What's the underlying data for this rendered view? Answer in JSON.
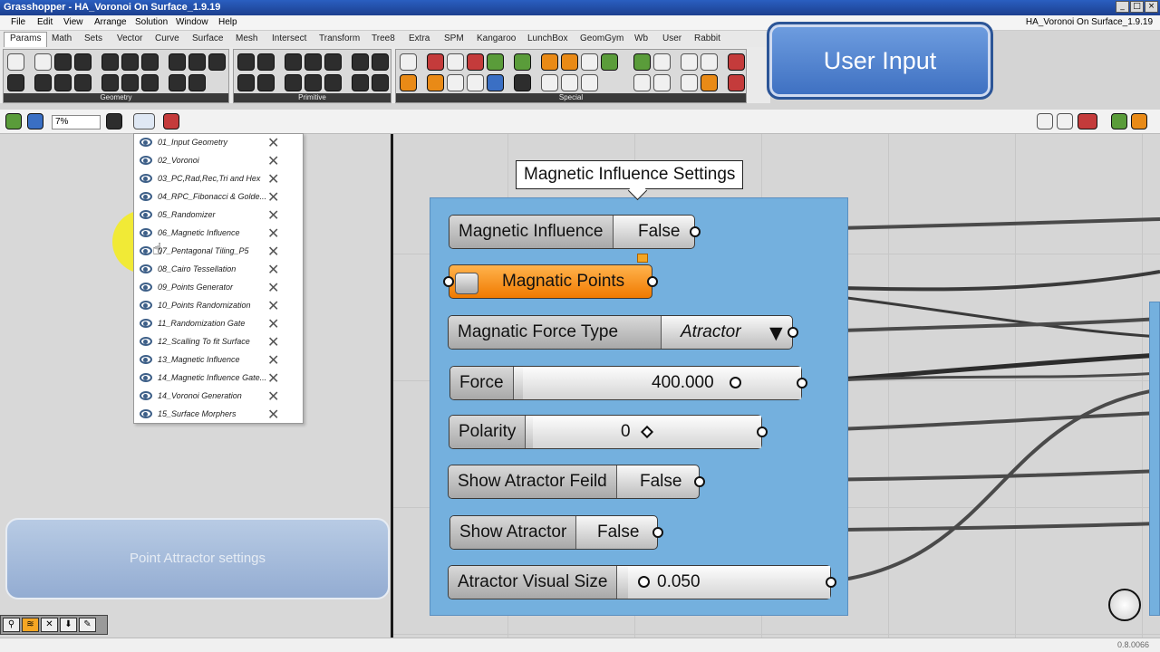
{
  "window": {
    "title": "Grasshopper - HA_Voronoi On Surface_1.9.19",
    "document_name": "HA_Voronoi On Surface_1.9.19"
  },
  "menu": [
    "File",
    "Edit",
    "View",
    "Arrange",
    "Solution",
    "Window",
    "Help"
  ],
  "tabs": [
    "Params",
    "Math",
    "Sets",
    "Vector",
    "Curve",
    "Surface",
    "Mesh",
    "Intersect",
    "Transform",
    "Tree8",
    "Extra",
    "SPM",
    "Kangaroo",
    "LunchBox",
    "GeomGym",
    "Wb",
    "User",
    "Rabbit"
  ],
  "ribbon_groups": [
    "Geometry",
    "Primitive",
    "Special"
  ],
  "zoom": "7%",
  "dropdown_items": [
    "01_Input Geometry",
    "02_Voronoi",
    "03_PC,Rad,Rec,Tri and Hex",
    "04_RPC_Fibonacci & Golde...",
    "05_Randomizer",
    "06_Magnetic Influence",
    "07_Pentagonal Tiling_P5",
    "08_Cairo Tessellation",
    "09_Points Generator",
    "10_Points Randomization",
    "11_Randomization Gate",
    "12_Scalling To fit Surface",
    "13_Magnetic Influence",
    "14_Magnetic Influence Gate...",
    "14_Voronoi Generation",
    "15_Surface Morphers"
  ],
  "group_label": "Magnetic Influence Settings",
  "components": {
    "magnetic_influence": {
      "name": "Magnetic Influence",
      "value": "False"
    },
    "magnatic_points": {
      "name": "Magnatic Points"
    },
    "force_type": {
      "name": "Magnatic Force Type",
      "value": "Atractor"
    },
    "force": {
      "name": "Force",
      "value": "400.000"
    },
    "polarity": {
      "name": "Polarity",
      "value": "0"
    },
    "show_feild": {
      "name": "Show Atractor Feild",
      "value": "False"
    },
    "show_atractor": {
      "name": "Show Atractor",
      "value": "False"
    },
    "visual_size": {
      "name": "Atractor Visual Size",
      "value": "0.050"
    }
  },
  "user_input_label": "User Input",
  "attractor_settings_label": "Point Attractor settings",
  "version": "0.8.0066",
  "colors": {
    "group_bg": "#74b0de",
    "accent_orange": "#f07a00",
    "title_bar": "#1c3f8f"
  }
}
